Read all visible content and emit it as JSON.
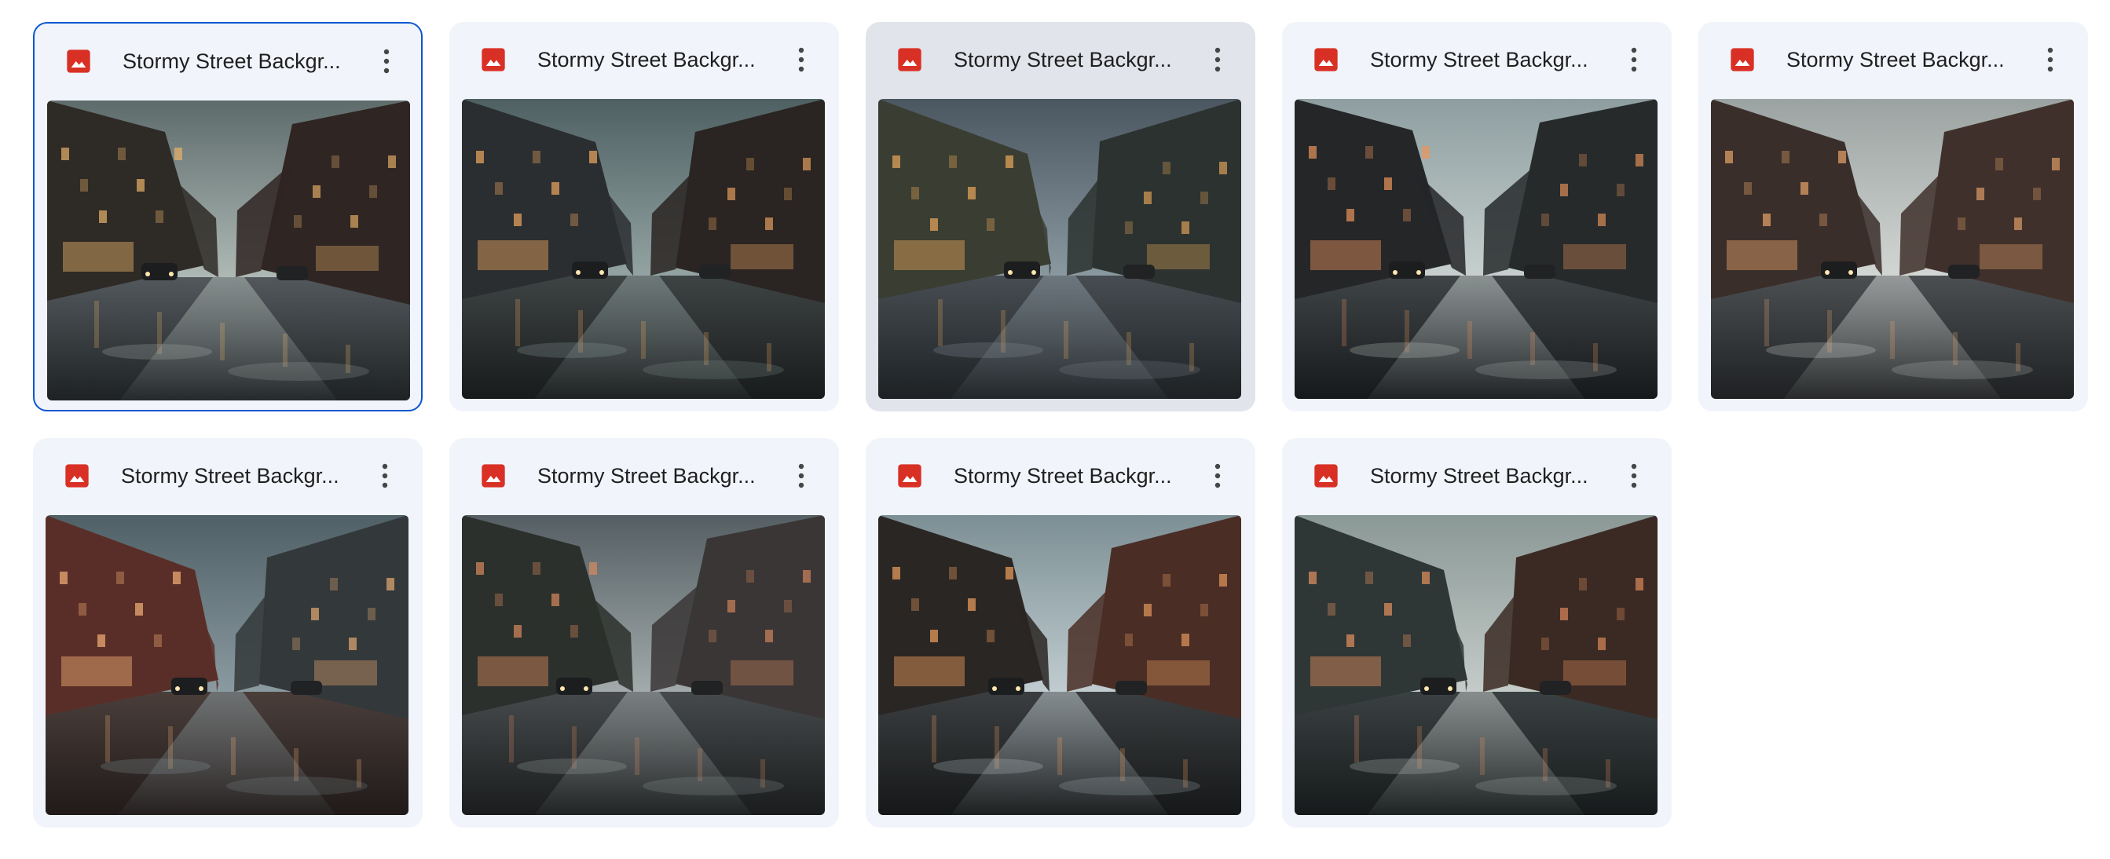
{
  "files": [
    {
      "name": "Stormy Street Backgr...",
      "icon": "image-file-icon",
      "state": "selected",
      "sky": [
        "#5d6b6b",
        "#aeb9b5"
      ],
      "ground": [
        "#52585c",
        "#1e2224"
      ],
      "left": "#2e2a26",
      "right": "#2f2523",
      "glow": "#e9b26a"
    },
    {
      "name": "Stormy Street Backgr...",
      "icon": "image-file-icon",
      "state": "normal",
      "sky": [
        "#4e6062",
        "#93a3a2"
      ],
      "ground": [
        "#3e4344",
        "#181b1c"
      ],
      "left": "#2b2e30",
      "right": "#2a2422",
      "glow": "#f0a860"
    },
    {
      "name": "Stormy Street Backgr...",
      "icon": "image-file-icon",
      "state": "hovered",
      "sky": [
        "#4a5660",
        "#8a98a0"
      ],
      "ground": [
        "#474d52",
        "#1d2124"
      ],
      "left": "#3a3d32",
      "right": "#2c3230",
      "glow": "#e8a85a"
    },
    {
      "name": "Stormy Street Backgr...",
      "icon": "image-file-icon",
      "state": "normal",
      "sky": [
        "#8e9ea0",
        "#c6cfcd"
      ],
      "ground": [
        "#3f4447",
        "#16191b"
      ],
      "left": "#252628",
      "right": "#262a2b",
      "glow": "#e9955a"
    },
    {
      "name": "Stormy Street Backgr...",
      "icon": "image-file-icon",
      "state": "normal",
      "sky": [
        "#9ba3a2",
        "#d2d6d3"
      ],
      "ground": [
        "#4b4f52",
        "#1e2022"
      ],
      "left": "#3a2e2a",
      "right": "#40302b",
      "glow": "#e8a46a"
    },
    {
      "name": "Stormy Street Backgr...",
      "icon": "image-file-icon",
      "state": "normal",
      "sky": [
        "#4f6066",
        "#8a9aa0"
      ],
      "ground": [
        "#4a3e3a",
        "#201a19"
      ],
      "left": "#5a2e28",
      "right": "#33383a",
      "glow": "#f3b276"
    },
    {
      "name": "Stormy Street Backgr...",
      "icon": "image-file-icon",
      "state": "normal",
      "sky": [
        "#555f63",
        "#a2aaab"
      ],
      "ground": [
        "#464a4c",
        "#1a1c1d"
      ],
      "left": "#2c302c",
      "right": "#3a3636",
      "glow": "#d98a5e"
    },
    {
      "name": "Stormy Street Backgr...",
      "icon": "image-file-icon",
      "state": "normal",
      "sky": [
        "#7c8f94",
        "#c0ccd0"
      ],
      "ground": [
        "#3b3e40",
        "#151718"
      ],
      "left": "#2a2623",
      "right": "#4a2e26",
      "glow": "#f0a060"
    },
    {
      "name": "Stormy Street Backgr...",
      "icon": "image-file-icon",
      "state": "normal",
      "sky": [
        "#8a9896",
        "#c4cbc8"
      ],
      "ground": [
        "#3a4142",
        "#161a1b"
      ],
      "left": "#2e3636",
      "right": "#3b2a24",
      "glow": "#e6915e"
    }
  ],
  "colors": {
    "accent": "#0b57d0",
    "image_icon": "#d93025",
    "card_bg": "#f1f4fb",
    "card_hover_bg": "#e1e4ea",
    "title_text": "#1f1f1f"
  },
  "more_icon": "more-vertical-icon"
}
